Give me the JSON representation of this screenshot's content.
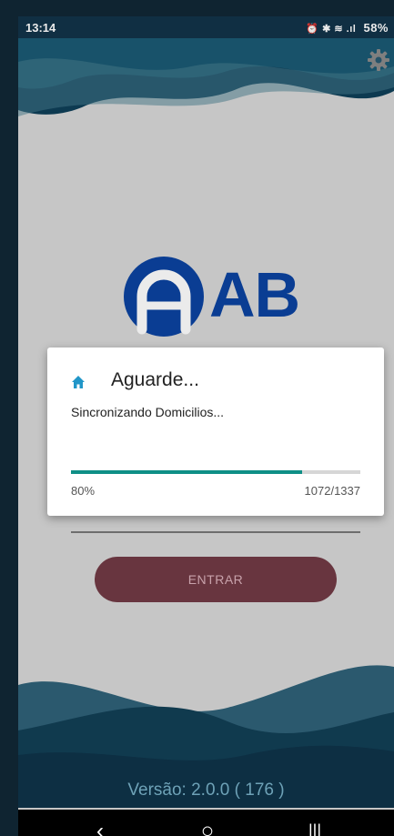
{
  "status_bar": {
    "time": "13:14",
    "icons": "⏰ ✱ ≋ .ıl",
    "battery": "58%"
  },
  "icons": {
    "settings": "gear-icon",
    "dialog": "home-icon",
    "nav_back": "back-icon",
    "nav_home": "home-circle-icon",
    "nav_recents": "recents-icon"
  },
  "logo": {
    "text": "AB"
  },
  "login": {
    "enter_label": "ENTRAR"
  },
  "dialog": {
    "title": "Aguarde...",
    "message": "Sincronizando Domicilios...",
    "progress_percent_label": "80%",
    "progress_count_label": "1072/1337",
    "progress_fraction": 0.8
  },
  "footer": {
    "version": "Versão: 2.0.0 ( 176 )"
  },
  "nav": {
    "back": "‹",
    "home": "○",
    "recents": "|||"
  },
  "colors": {
    "accent": "#0f8f86",
    "brand": "#0b43a0",
    "button": "#68353f",
    "status_bar": "#123349"
  }
}
